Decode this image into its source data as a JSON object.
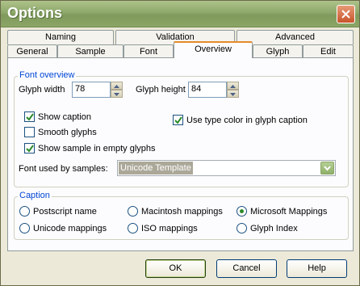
{
  "window": {
    "title": "Options"
  },
  "tabs_back": [
    "Naming",
    "Validation",
    "Advanced"
  ],
  "tabs_front": [
    "General",
    "Sample",
    "Font",
    "Overview",
    "Glyph",
    "Edit"
  ],
  "active_tab": "Overview",
  "font_overview": {
    "group_label": "Font overview",
    "glyph_width_label": "Glyph width",
    "glyph_width_value": "78",
    "glyph_height_label": "Glyph height",
    "glyph_height_value": "84",
    "show_caption_label": "Show caption",
    "show_caption_checked": true,
    "smooth_glyphs_label": "Smooth glyphs",
    "smooth_glyphs_checked": false,
    "show_sample_label": "Show sample in empty glyphs",
    "show_sample_checked": true,
    "use_type_color_label": "Use type color in glyph caption",
    "use_type_color_checked": true,
    "font_samples_label": "Font used by samples:",
    "font_samples_value": "Unicode Template"
  },
  "caption": {
    "group_label": "Caption",
    "options": [
      "Postscript name",
      "Macintosh mappings",
      "Microsoft Mappings",
      "Unicode mappings",
      "ISO mappings",
      "Glyph Index"
    ],
    "selected": "Microsoft Mappings"
  },
  "buttons": {
    "ok": "OK",
    "cancel": "Cancel",
    "help": "Help"
  },
  "colors": {
    "accent_tab": "#e68b2c",
    "group_label": "#0046d5",
    "check": "#2b8a2b"
  }
}
